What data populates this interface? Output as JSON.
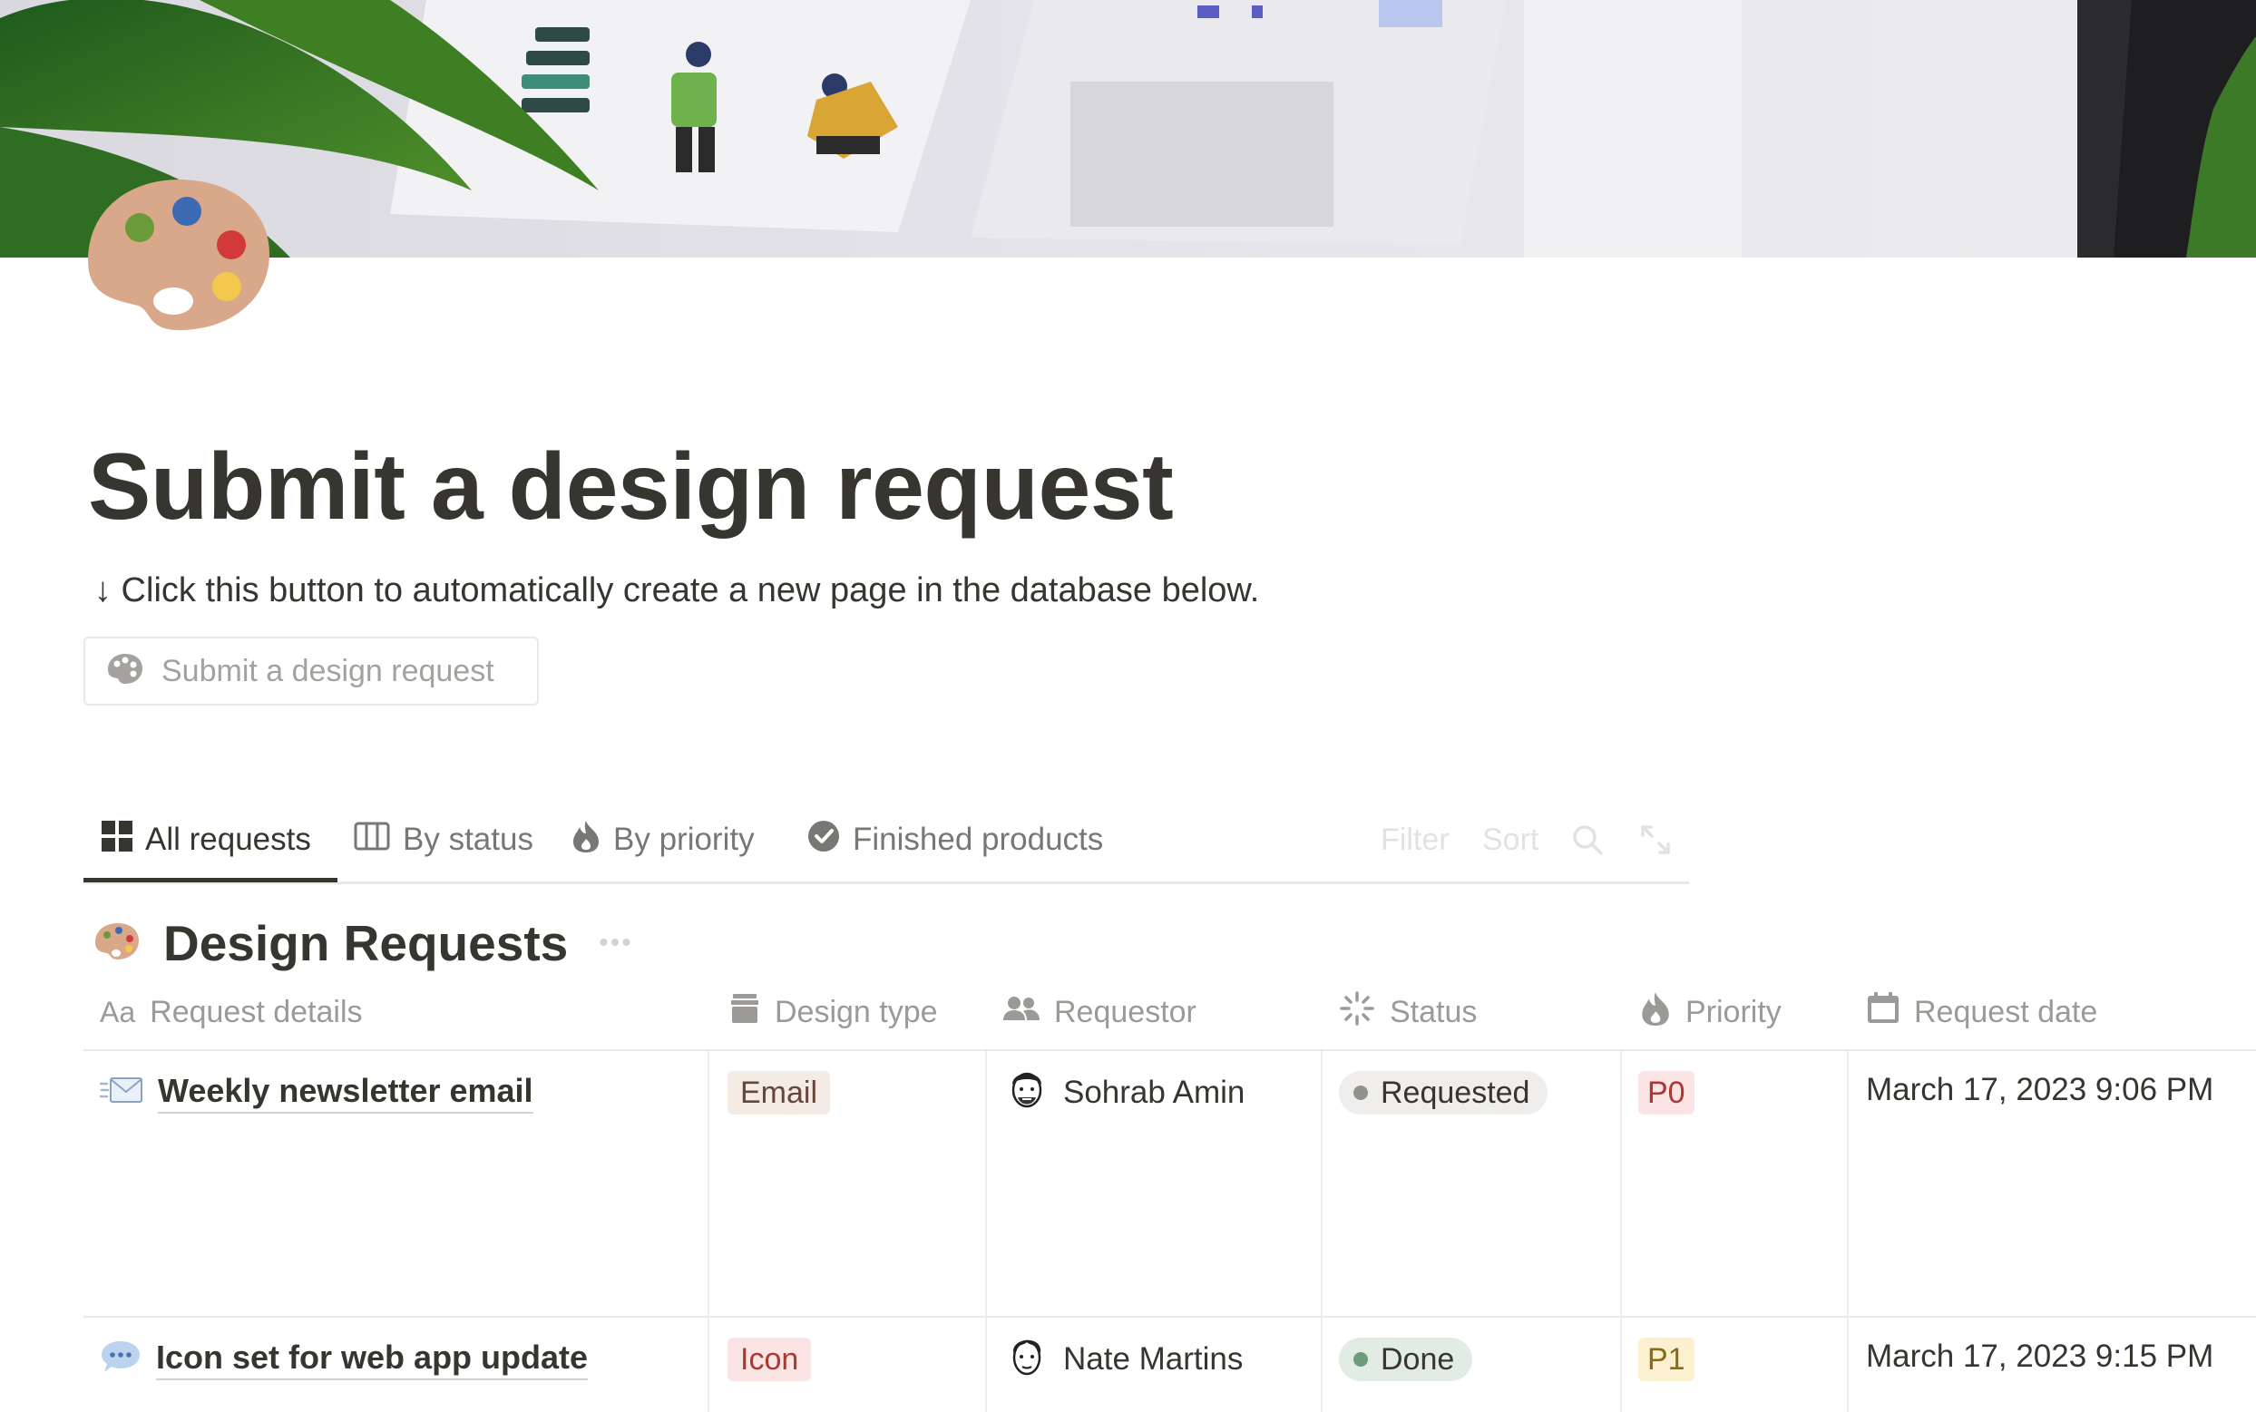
{
  "page": {
    "title": "Submit a design request",
    "hint": "↓ Click this button to automatically create a new page in the database below.",
    "button_label": "Submit a design request"
  },
  "tabs": [
    {
      "label": "All requests",
      "icon": "grid-icon",
      "active": true
    },
    {
      "label": "By status",
      "icon": "board-icon",
      "active": false
    },
    {
      "label": "By priority",
      "icon": "fire-icon",
      "active": false
    },
    {
      "label": "Finished products",
      "icon": "check-circle-icon",
      "active": false
    }
  ],
  "toolbar": {
    "filter": "Filter",
    "sort": "Sort",
    "search_icon": "search-icon",
    "expand_icon": "expand-icon"
  },
  "database": {
    "title": "Design Requests",
    "columns": [
      {
        "label": "Request details",
        "icon": "text-aa-icon",
        "prefix": "Aa"
      },
      {
        "label": "Design type",
        "icon": "archive-icon"
      },
      {
        "label": "Requestor",
        "icon": "people-icon"
      },
      {
        "label": "Status",
        "icon": "loading-icon"
      },
      {
        "label": "Priority",
        "icon": "fire-icon"
      },
      {
        "label": "Request date",
        "icon": "calendar-icon"
      }
    ],
    "rows": [
      {
        "title": "Weekly newsletter email",
        "icon": "envelope-icon",
        "design_type": "Email",
        "requestor": "Sohrab Amin",
        "status": "Requested",
        "priority": "P0",
        "date": "March 17, 2023 9:06 PM"
      },
      {
        "title": "Icon set for web app update",
        "icon": "speech-bubble-icon",
        "design_type": "Icon",
        "requestor": "Nate Martins",
        "status": "Done",
        "priority": "P1",
        "date": "March 17, 2023 9:15 PM"
      }
    ]
  },
  "colors": {
    "text": "#37352f",
    "muted": "#9b9a97",
    "tag_email_bg": "#f3ebe4",
    "tag_icon_bg": "#fbe4e4",
    "status_requested_bg": "#efeeec",
    "status_done_bg": "#e0ece4",
    "priority_p0_bg": "#fbe4e4",
    "priority_p1_bg": "#fbf0cf"
  }
}
